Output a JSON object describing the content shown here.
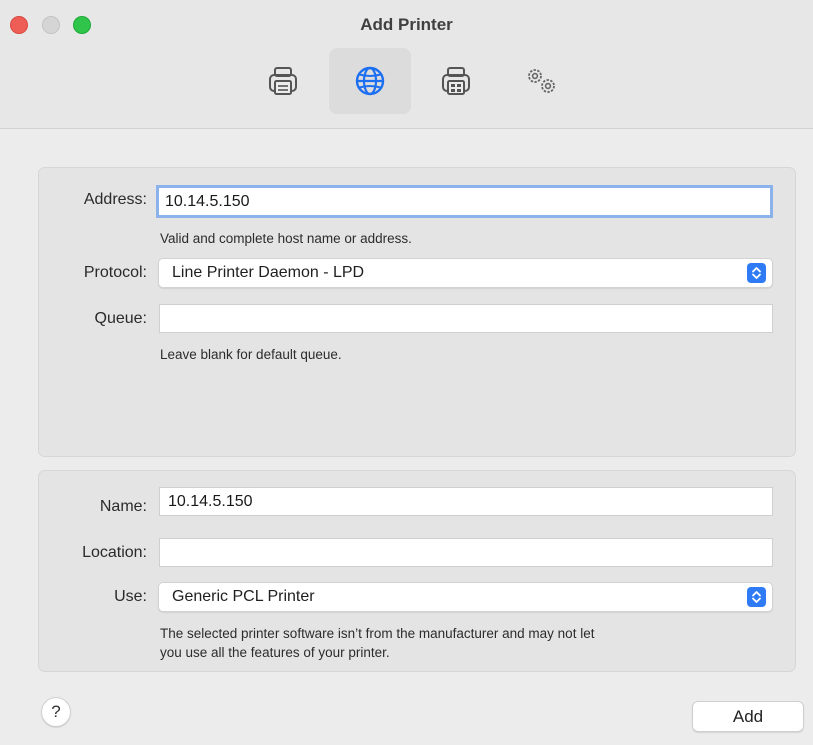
{
  "window": {
    "title": "Add Printer"
  },
  "toolbar": {
    "items": [
      {
        "icon": "printer-icon",
        "selected": false
      },
      {
        "icon": "globe-icon",
        "selected": true
      },
      {
        "icon": "windows-printer-icon",
        "selected": false
      },
      {
        "icon": "advanced-gears-icon",
        "selected": false
      }
    ]
  },
  "connection": {
    "address_label": "Address:",
    "address_value": "10.14.5.150",
    "address_hint": "Valid and complete host name or address.",
    "protocol_label": "Protocol:",
    "protocol_value": "Line Printer Daemon - LPD",
    "queue_label": "Queue:",
    "queue_value": "",
    "queue_hint": "Leave blank for default queue."
  },
  "details": {
    "name_label": "Name:",
    "name_value": "10.14.5.150",
    "location_label": "Location:",
    "location_value": "",
    "use_label": "Use:",
    "use_value": "Generic PCL Printer",
    "use_hint_line1": "The selected printer software isn’t from the manufacturer and may not let",
    "use_hint_line2": "you use all the features of your printer."
  },
  "footer": {
    "help_label": "?",
    "add_label": "Add"
  },
  "colors": {
    "accent": "#2f7bf6",
    "focus_ring": "#8cb2ec",
    "close": "#ee5e57",
    "maximize": "#2fc44a"
  }
}
